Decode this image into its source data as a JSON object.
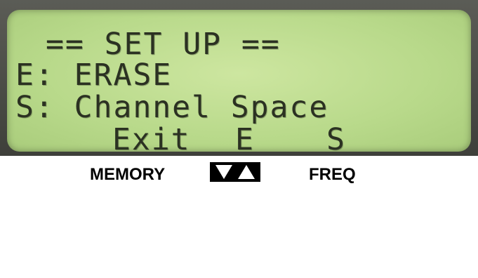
{
  "lcd": {
    "title": "== SET UP ==",
    "option_erase": "E: ERASE",
    "option_channel_space": "S: Channel Space",
    "softkeys": {
      "exit": "Exit",
      "e": "E",
      "s": "S"
    }
  },
  "buttons": {
    "memory": "MEMORY",
    "freq": "FREQ",
    "arrows_icon": "down-up-arrows-icon"
  },
  "colors": {
    "lcd_background": "#b8d98a",
    "lcd_text": "#2b3122",
    "bezel": "#4a4b45"
  }
}
